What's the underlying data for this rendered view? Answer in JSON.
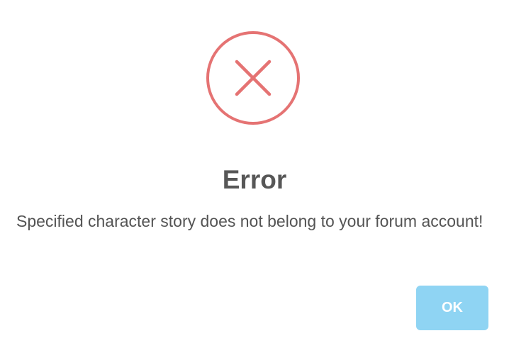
{
  "dialog": {
    "icon": "error-x-circle-icon",
    "title": "Error",
    "message": "Specified character story does not belong to your forum account!",
    "ok_label": "OK"
  },
  "colors": {
    "icon_red": "#e57373",
    "title_text": "#575757",
    "message_text": "#545454",
    "button_bg": "#8fd4f3",
    "button_text": "#ffffff"
  }
}
